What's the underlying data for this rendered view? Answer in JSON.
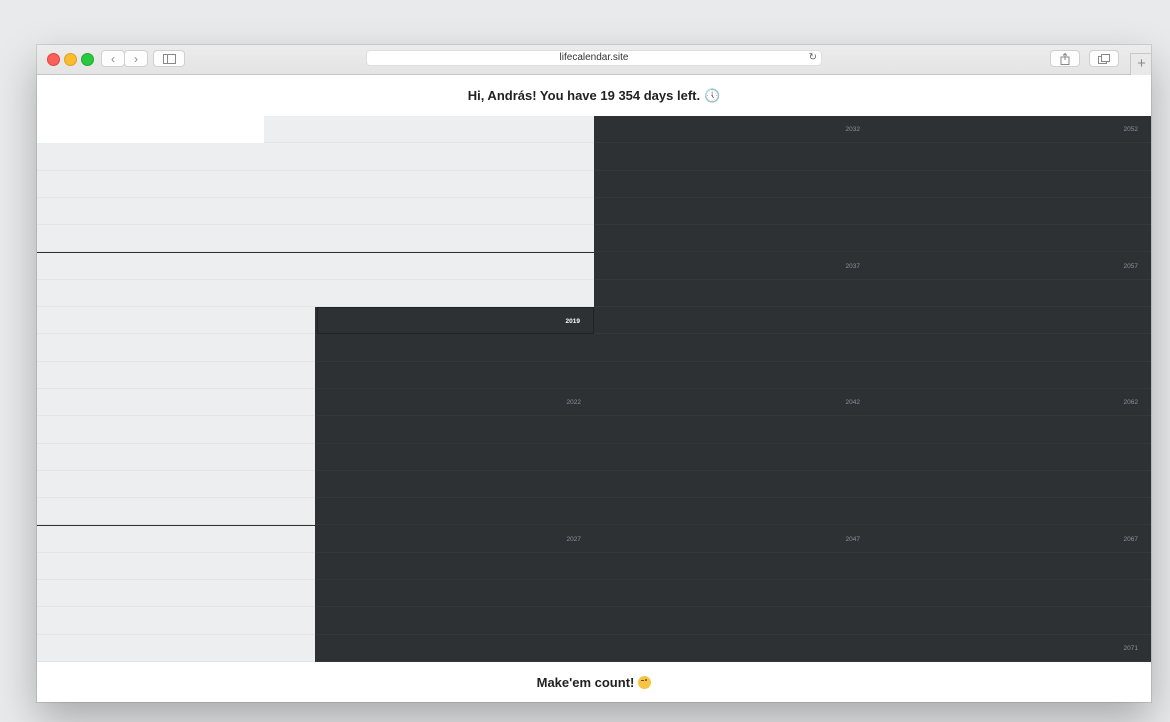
{
  "browser": {
    "url": "lifecalendar.site",
    "icons": [
      "chevron-left-icon",
      "chevron-right-icon",
      "sidebar-icon",
      "reload-icon",
      "share-icon",
      "tabs-icon",
      "plus-icon"
    ]
  },
  "page": {
    "headline": "Hi, András! You have 19 354 days left.",
    "headline_icon": "clock-icon",
    "footer": "Make'em count!",
    "footer_icon": "wink-emoji-icon"
  },
  "calendar": {
    "current_year": "2019",
    "visible_year_labels": [
      {
        "col": 2,
        "row": 0,
        "year": "2032"
      },
      {
        "col": 3,
        "row": 0,
        "year": "2052"
      },
      {
        "col": 2,
        "row": 5,
        "year": "2037"
      },
      {
        "col": 3,
        "row": 5,
        "year": "2057"
      },
      {
        "col": 1,
        "row": 7,
        "year": "2019"
      },
      {
        "col": 1,
        "row": 10,
        "year": "2022"
      },
      {
        "col": 2,
        "row": 10,
        "year": "2042"
      },
      {
        "col": 3,
        "row": 10,
        "year": "2062"
      },
      {
        "col": 1,
        "row": 15,
        "year": "2027"
      },
      {
        "col": 2,
        "row": 15,
        "year": "2047"
      },
      {
        "col": 3,
        "row": 15,
        "year": "2067"
      },
      {
        "col": 3,
        "row": 19,
        "year": "2071"
      }
    ],
    "colors": {
      "lived": "#eceeef",
      "remaining": "#2d3134",
      "current_label": "#ffffff"
    }
  }
}
